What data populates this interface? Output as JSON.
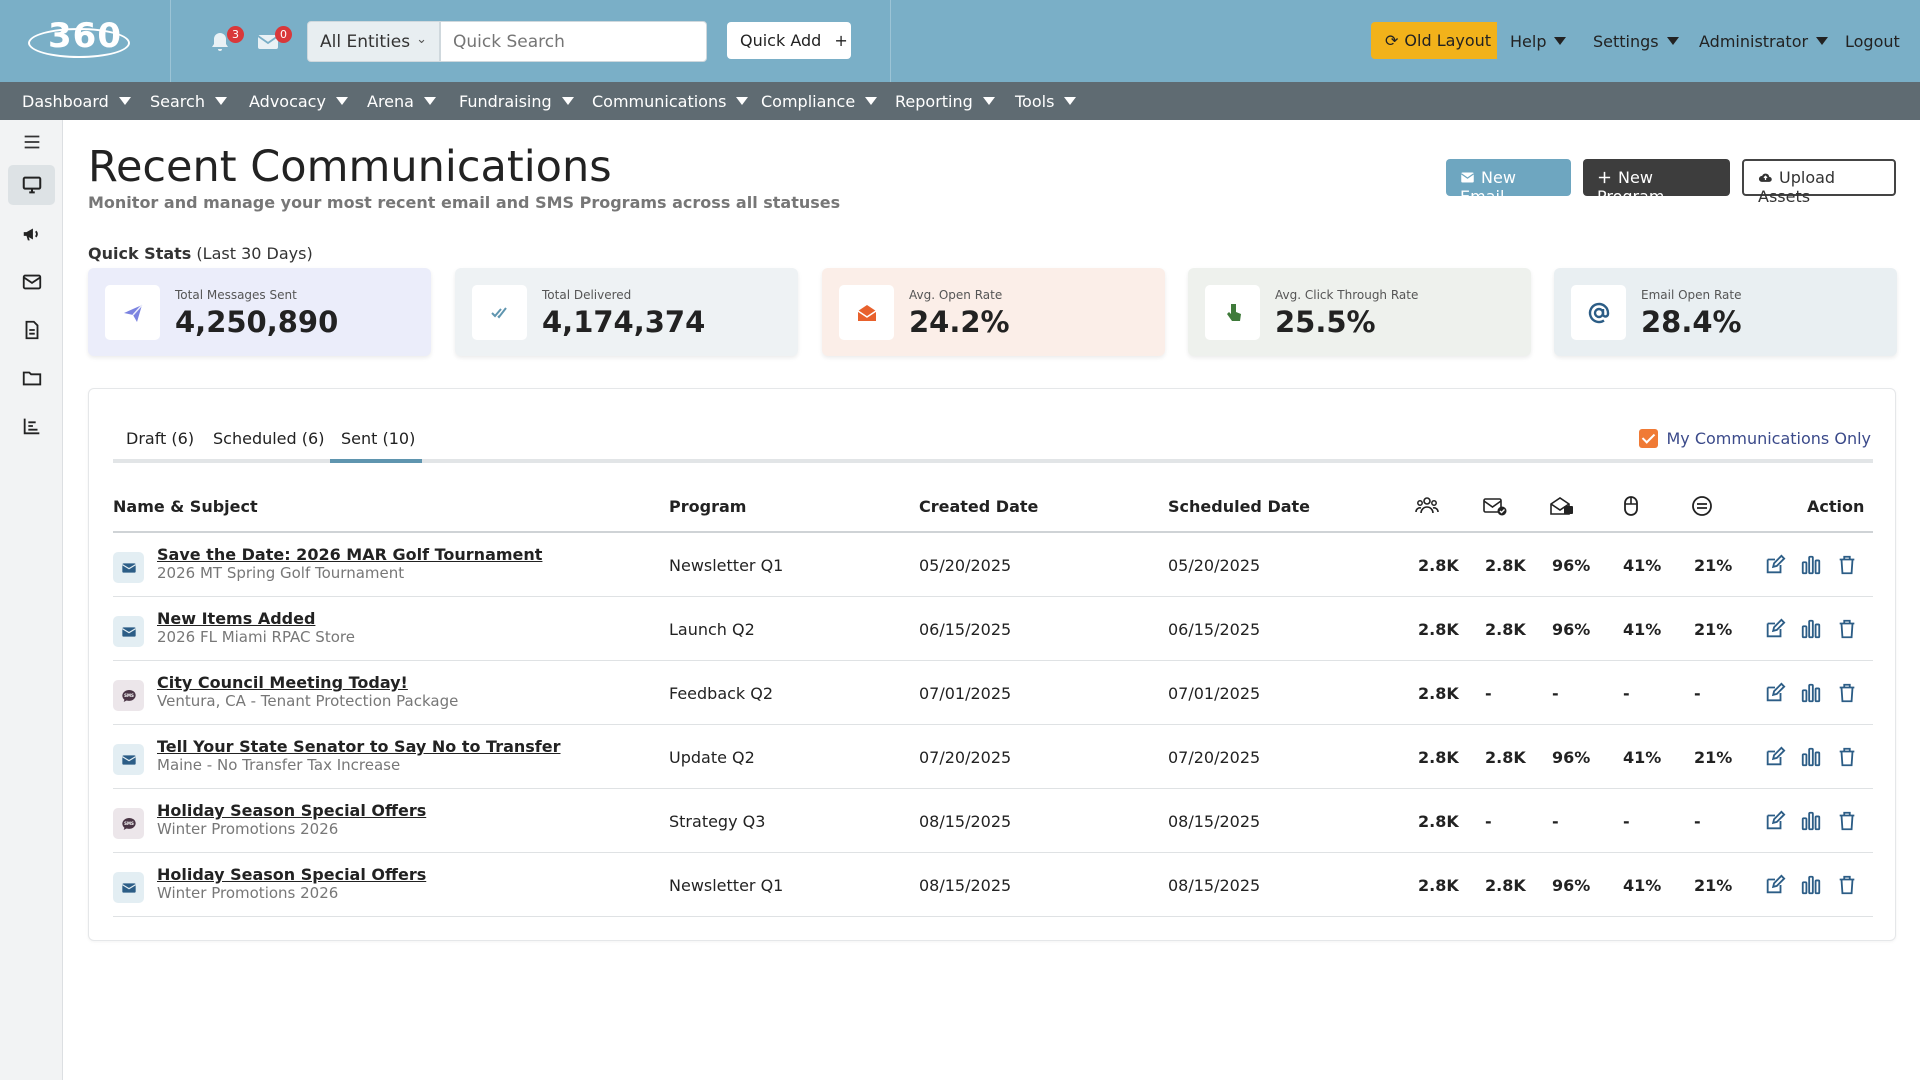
{
  "topbar": {
    "logo": "360",
    "notifications_count": "3",
    "messages_count": "0",
    "entity_select": "All Entities",
    "search_placeholder": "Quick Search",
    "quick_add": "Quick Add",
    "old_layout": "Old Layout",
    "help": "Help",
    "settings": "Settings",
    "administrator": "Administrator",
    "logout": "Logout"
  },
  "nav": [
    "Dashboard",
    "Search",
    "Advocacy",
    "Arena",
    "Fundraising",
    "Communications",
    "Compliance",
    "Reporting",
    "Tools"
  ],
  "header": {
    "title": "Recent Communications",
    "subtitle": "Monitor and manage your most recent email and SMS Programs across all statuses",
    "new_email": "New Email",
    "new_program": "New Program",
    "upload_assets": "Upload Assets"
  },
  "quick_stats": {
    "label": "Quick Stats",
    "period": "(Last 30 Days)",
    "cards": [
      {
        "label": "Total Messages Sent",
        "value": "4,250,890",
        "icon": "paper-plane-icon",
        "bg": "#ebedfa",
        "color": "#7b83e0"
      },
      {
        "label": "Total Delivered",
        "value": "4,174,374",
        "icon": "double-check-icon",
        "bg": "#eef2f4",
        "color": "#5f95af"
      },
      {
        "label": "Avg. Open Rate",
        "value": "24.2%",
        "icon": "open-envelope-icon",
        "bg": "#fbeee8",
        "color": "#e8612c"
      },
      {
        "label": "Avg. Click Through Rate",
        "value": "25.5%",
        "icon": "pointer-hand-icon",
        "bg": "#eef1ed",
        "color": "#3f7a3a"
      },
      {
        "label": "Email Open Rate",
        "value": "28.4%",
        "icon": "at-sign-icon",
        "bg": "#e9eff2",
        "color": "#2c5d86"
      }
    ]
  },
  "tabs": [
    {
      "label": "Draft (6)"
    },
    {
      "label": "Scheduled (6)"
    },
    {
      "label": "Sent (10)"
    }
  ],
  "my_communications_only": "My Communications Only",
  "table": {
    "headers": {
      "name": "Name & Subject",
      "program": "Program",
      "created": "Created Date",
      "scheduled": "Scheduled Date",
      "action": "Action"
    },
    "icon_headers": [
      "recipients-icon",
      "delivered-icon",
      "opened-icon",
      "clicks-icon",
      "unsubscribe-icon"
    ],
    "rows": [
      {
        "type": "email",
        "name": "Save the Date: 2026 MAR Golf Tournament",
        "subject": "2026 MT Spring Golf Tournament",
        "program": "Newsletter Q1",
        "created": "05/20/2025",
        "scheduled": "05/20/2025",
        "recipients": "2.8K",
        "delivered": "2.8K",
        "opened": "96%",
        "clicks": "41%",
        "unsub": "21%"
      },
      {
        "type": "email",
        "name": "New Items Added",
        "subject": "2026 FL Miami RPAC Store",
        "program": "Launch Q2",
        "created": "06/15/2025",
        "scheduled": "06/15/2025",
        "recipients": "2.8K",
        "delivered": "2.8K",
        "opened": "96%",
        "clicks": "41%",
        "unsub": "21%"
      },
      {
        "type": "sms",
        "name": "City Council Meeting Today!",
        "subject": "Ventura, CA - Tenant Protection Package",
        "program": "Feedback Q2",
        "created": "07/01/2025",
        "scheduled": "07/01/2025",
        "recipients": "2.8K",
        "delivered": "-",
        "opened": "-",
        "clicks": "-",
        "unsub": "-"
      },
      {
        "type": "email",
        "name": "Tell Your State Senator to Say    No to Transfer ",
        "subject": "Maine - No Transfer Tax Increase",
        "program": "Update Q2",
        "created": "07/20/2025",
        "scheduled": "07/20/2025",
        "recipients": "2.8K",
        "delivered": "2.8K",
        "opened": "96%",
        "clicks": "41%",
        "unsub": "21%"
      },
      {
        "type": "sms",
        "name": "Holiday Season Special Offers",
        "subject": "Winter Promotions 2026",
        "program": "Strategy Q3",
        "created": "08/15/2025",
        "scheduled": "08/15/2025",
        "recipients": "2.8K",
        "delivered": "-",
        "opened": "-",
        "clicks": "-",
        "unsub": "-"
      },
      {
        "type": "email",
        "name": "Holiday Season Special Offers",
        "subject": "Winter Promotions 2026",
        "program": "Newsletter Q1",
        "created": "08/15/2025",
        "scheduled": "08/15/2025",
        "recipients": "2.8K",
        "delivered": "2.8K",
        "opened": "96%",
        "clicks": "41%",
        "unsub": "21%"
      }
    ]
  }
}
